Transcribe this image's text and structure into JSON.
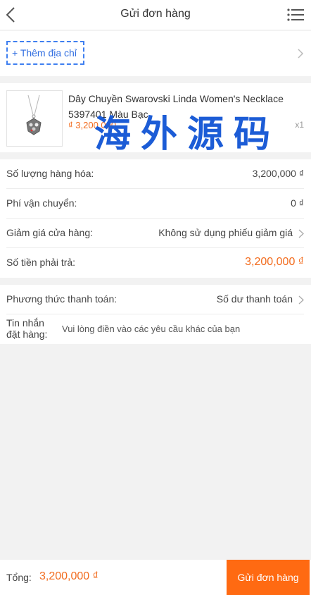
{
  "header": {
    "title": "Gửi đơn hàng"
  },
  "address": {
    "add_label": "+ Thêm địa chỉ"
  },
  "product": {
    "name": "Dây Chuyền Swarovski Linda Women's Necklace 5397401 Màu Bạc",
    "price": "₫ 3,200,000",
    "qty": "x1"
  },
  "watermark": {
    "text": "海外源码"
  },
  "summary": {
    "goods_label": "Số lượng hàng hóa:",
    "goods_value": "3,200,000 ₫",
    "shipping_label": "Phí vận chuyển:",
    "shipping_value": "0 ₫",
    "discount_label": "Giảm giá cửa hàng:",
    "discount_value": "Không sử dụng phiếu giảm giá",
    "payable_label": "Số tiền phải trả:",
    "payable_value": "3,200,000 ₫"
  },
  "payment": {
    "method_label": "Phương thức thanh toán:",
    "method_value": "Số dư thanh toán",
    "note_label": "Tin nhắn đặt hàng:",
    "note_placeholder": "Vui lòng điền vào các yêu cầu khác của bạn"
  },
  "footer": {
    "total_label": "Tổng:",
    "total_value": "3,200,000 ₫",
    "submit_label": "Gửi đơn hàng"
  },
  "colors": {
    "accent": "#ff6a12",
    "price": "#f26b1d",
    "link": "#2f6de0"
  }
}
